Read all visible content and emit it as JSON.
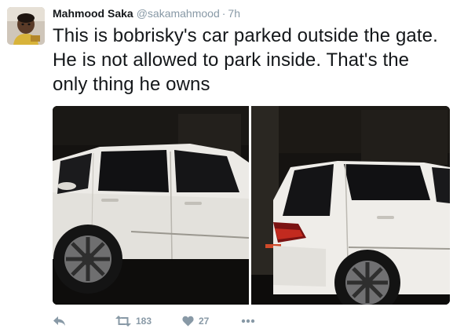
{
  "tweet": {
    "author_name": "Mahmood Saka",
    "author_handle": "@sakamahmood",
    "separator": "·",
    "time": "7h",
    "text": "This is bobrisky's car parked outside the gate. He is not allowed to park inside. That's the only thing he owns"
  },
  "actions": {
    "retweets": "183",
    "likes": "27"
  },
  "icons": {
    "reply": "reply-icon",
    "retweet": "retweet-icon",
    "like": "heart-icon",
    "more": "more-dots-icon"
  },
  "colors": {
    "text": "#14171a",
    "muted": "#8899a6"
  }
}
